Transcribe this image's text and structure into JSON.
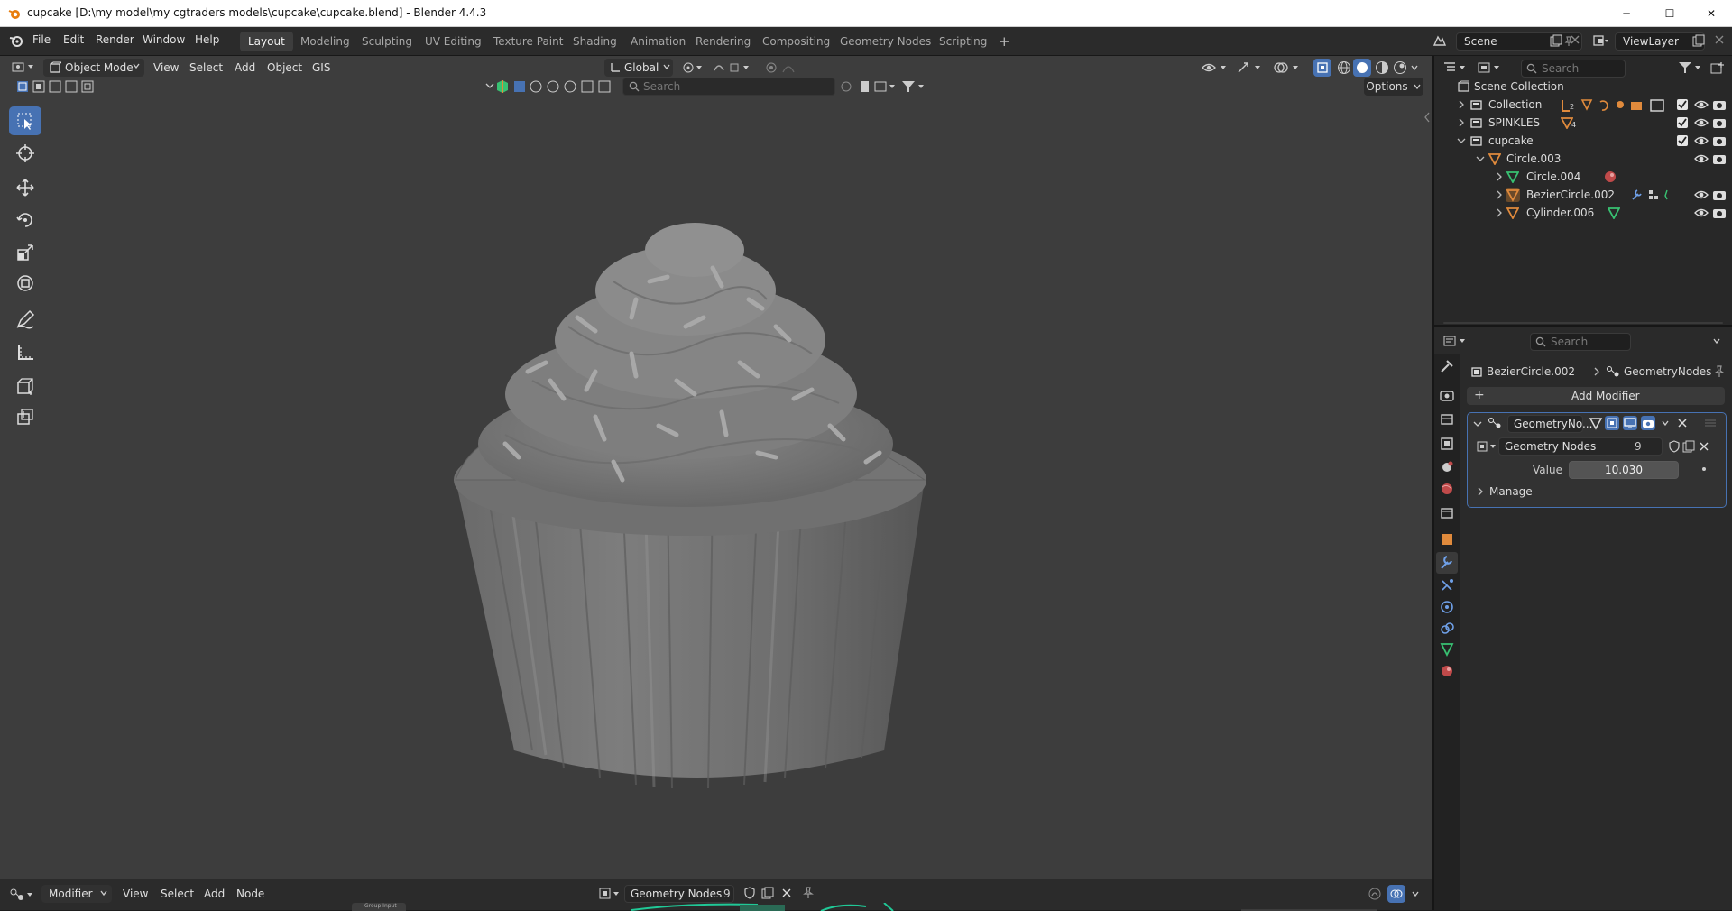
{
  "window": {
    "title": "cupcake [D:\\my model\\my cgtraders models\\cupcake\\cupcake.blend] - Blender 4.4.3",
    "min_glyph": "─",
    "max_glyph": "☐",
    "close_glyph": "✕"
  },
  "menu": [
    "File",
    "Edit",
    "Render",
    "Window",
    "Help"
  ],
  "workspaces": [
    "Layout",
    "Modeling",
    "Sculpting",
    "UV Editing",
    "Texture Paint",
    "Shading",
    "Animation",
    "Rendering",
    "Compositing",
    "Geometry Nodes",
    "Scripting"
  ],
  "workspace_add": "+",
  "scene": {
    "name": "Scene",
    "view_layer": "ViewLayer"
  },
  "viewport": {
    "mode": "Object Mode",
    "menus": [
      "View",
      "Select",
      "Add",
      "Object",
      "GIS"
    ],
    "orientation": "Global",
    "search_placeholder": "Search",
    "options_label": "Options",
    "tools": [
      "select-box",
      "cursor",
      "move",
      "rotate",
      "scale",
      "transform",
      "annotate",
      "measure",
      "add-cube",
      "extrude"
    ]
  },
  "outliner": {
    "search_placeholder": "Search",
    "root": "Scene Collection",
    "rows": [
      {
        "label": "Collection",
        "badge": "2"
      },
      {
        "label": "SPINKLES",
        "badge": "4"
      },
      {
        "label": "cupcake"
      },
      {
        "label": "Circle.003"
      },
      {
        "label": "Circle.004"
      },
      {
        "label": "BezierCircle.002"
      },
      {
        "label": "Cylinder.006"
      }
    ]
  },
  "properties": {
    "search_placeholder": "Search",
    "breadcrumb_object": "BezierCircle.002",
    "breadcrumb_modifier": "GeometryNodes",
    "add_modifier": "Add Modifier",
    "modifier_name": "GeometryNo...",
    "node_group": "Geometry Nodes",
    "node_users": "9",
    "value_label": "Value",
    "value": "10.030",
    "manage_label": "Manage"
  },
  "bottom": {
    "editor_mode": "Modifier",
    "menus": [
      "View",
      "Select",
      "Add",
      "Node"
    ],
    "node_group": "Geometry Nodes",
    "node_users": "9",
    "node_hint": "Group Input"
  },
  "colors": {
    "accent": "#4772b3",
    "viewport_bg": "#3d3d3d",
    "mesh_orange": "#e08a3c",
    "mesh_green": "#38c172"
  }
}
